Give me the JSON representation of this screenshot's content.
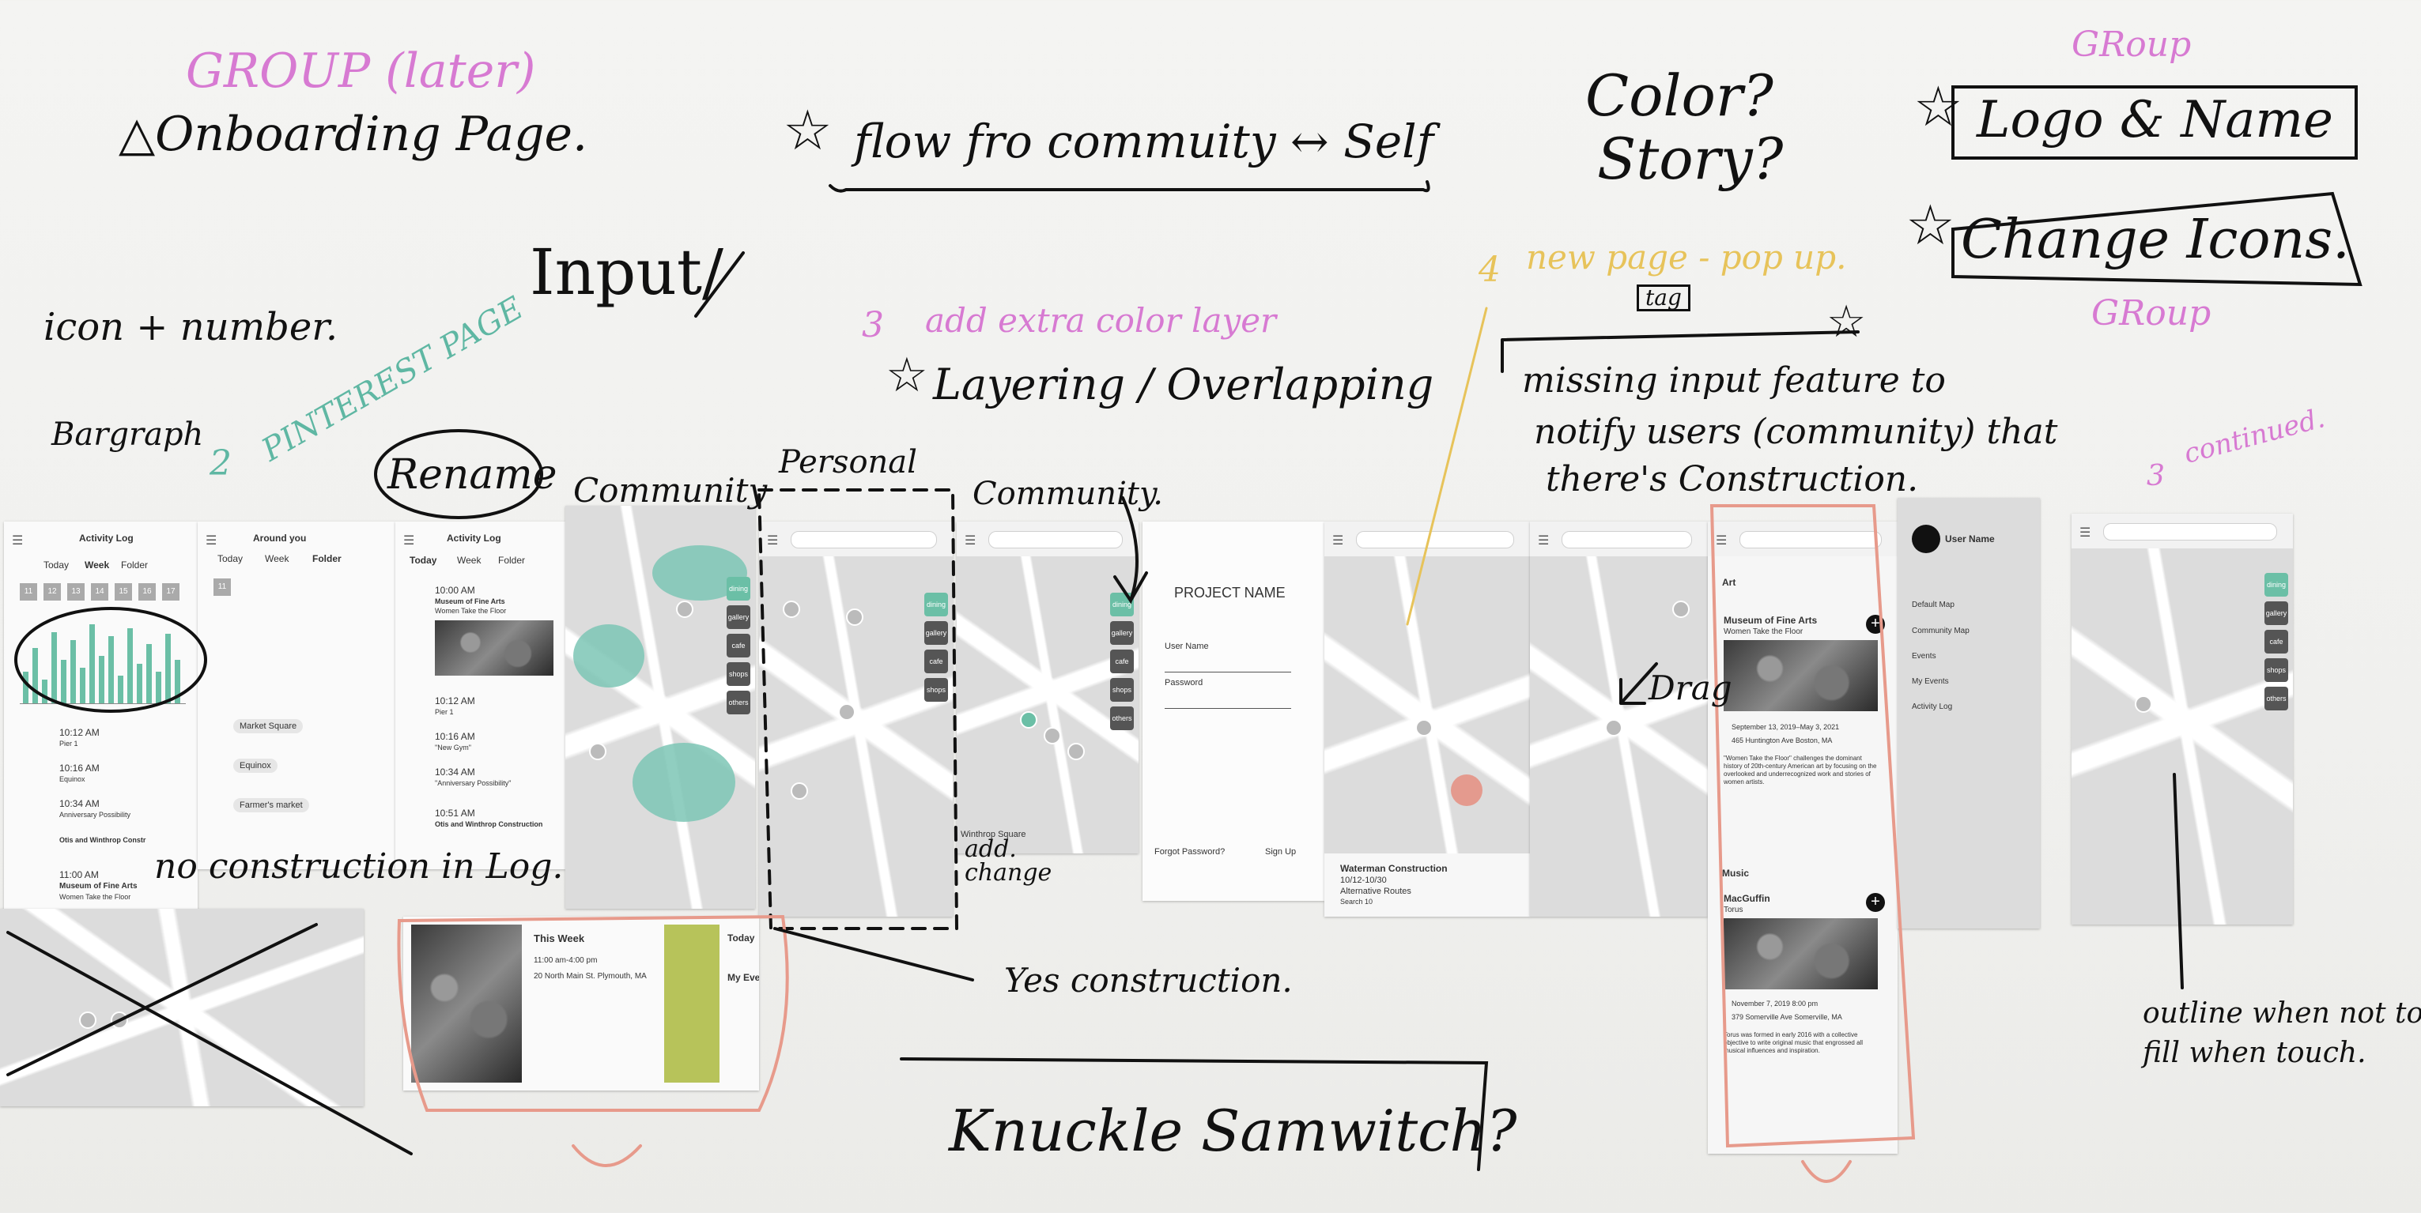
{
  "notes": {
    "group_later": "GROUP (later)",
    "onboarding": "△Onboarding Page.",
    "flow": "flow fro commuity ↔ Self",
    "color": "Color?",
    "story": "Story?",
    "group1": "GRoup",
    "logo_name": "Logo & Name",
    "change_icons": "Change Icons.",
    "group2": "GRoup",
    "input": "Input/",
    "icon_number": "icon + number.",
    "bargraph": "Bargraph",
    "pinterest": "PINTEREST PAGE",
    "rename": "Rename",
    "add_color": "add extra color layer",
    "layering": "Layering / Overlapping",
    "community1": "Community",
    "personal": "Personal",
    "community2": "Community.",
    "new_page": "new page - pop up.",
    "tag": "tag",
    "missing": "missing input feature to",
    "notify": "notify users (community) that",
    "theres": "there's Construction.",
    "continued": "continued.",
    "drag": "Drag",
    "no_construction": "no construction in Log.",
    "add_change": "add. change",
    "yes_construction": "Yes construction.",
    "knuckle": "Knuckle Samwitch?",
    "outline": "outline when not touch",
    "fill": "fill when touch.",
    "num2": "2",
    "num3a": "3",
    "num4": "4",
    "num3b": "3"
  },
  "screens": {
    "activity": {
      "title": "Activity Log",
      "tabs": [
        "Today",
        "Week",
        "Folder"
      ],
      "days": [
        "11",
        "12",
        "13",
        "14",
        "15",
        "16",
        "17"
      ],
      "entries": [
        {
          "time": "10:12 AM",
          "label": "Pier 1"
        },
        {
          "time": "10:16 AM",
          "label": "Equinox"
        },
        {
          "time": "10:34 AM",
          "label": "Anniversary Possibility"
        },
        {
          "time": "",
          "label": "Otis and Winthrop Constr"
        },
        {
          "time": "11:00 AM",
          "label": "Museum of Fine Arts"
        }
      ],
      "sub": "Women Take the Floor"
    },
    "around": {
      "title": "Around you",
      "tabs": [
        "Today",
        "Week",
        "Folder"
      ],
      "items": [
        "Market Square",
        "Equinox",
        "Farmer's market"
      ]
    },
    "activity2": {
      "title": "Activity Log",
      "tabs": [
        "Today",
        "Week",
        "Folder"
      ],
      "entries": [
        {
          "time": "10:00 AM",
          "label": "Museum of Fine Arts",
          "sub": "Women Take the Floor"
        },
        {
          "time": "10:12 AM",
          "label": "Pier 1"
        },
        {
          "time": "10:16 AM",
          "label": "\"New Gym\""
        },
        {
          "time": "10:34 AM",
          "label": "\"Anniversary Possibility\""
        },
        {
          "time": "10:51 AM",
          "label": "Otis and Winthrop Construction"
        }
      ]
    },
    "login": {
      "project": "PROJECT NAME",
      "user": "User Name",
      "password": "Password",
      "forgot": "Forgot Password?",
      "signup": "Sign Up"
    },
    "construction": {
      "title": "Waterman Construction",
      "dates": "10/12-10/30",
      "routes": "Alternative Routes",
      "extra": "Search 10"
    },
    "side_labels": [
      "dining",
      "gallery",
      "cafe",
      "shops",
      "others"
    ],
    "winthrop": "Winthrop Square",
    "events": {
      "art_header": "Art",
      "museum": "Museum of Fine Arts",
      "museum_sub": "Women Take the Floor",
      "museum_dates": "September 13, 2019–May 3, 2021",
      "museum_addr": "465 Huntington Ave Boston, MA",
      "museum_desc": "\"Women Take the Floor\" challenges the dominant history of 20th-century American art by focusing on the overlooked and underrecognized work and stories of women artists.",
      "music_header": "Music",
      "band": "MacGuffin",
      "band_sub": "Torus",
      "band_date": "November 7, 2019 8:00 pm",
      "band_addr": "379 Somerville Ave Somerville, MA",
      "band_desc": "Torus was formed in early 2016 with a collective objective to write original music that engrossed all musical influences and inspiration."
    },
    "menu": {
      "user": "User Name",
      "items": [
        "Default Map",
        "Community Map",
        "Events",
        "My Events",
        "Activity Log"
      ]
    },
    "myevents": {
      "today": "Today",
      "my": "My Events",
      "week": "This Week",
      "time": "11:00 am-4:00 pm",
      "addr": "20 North Main St. Plymouth, MA"
    }
  }
}
